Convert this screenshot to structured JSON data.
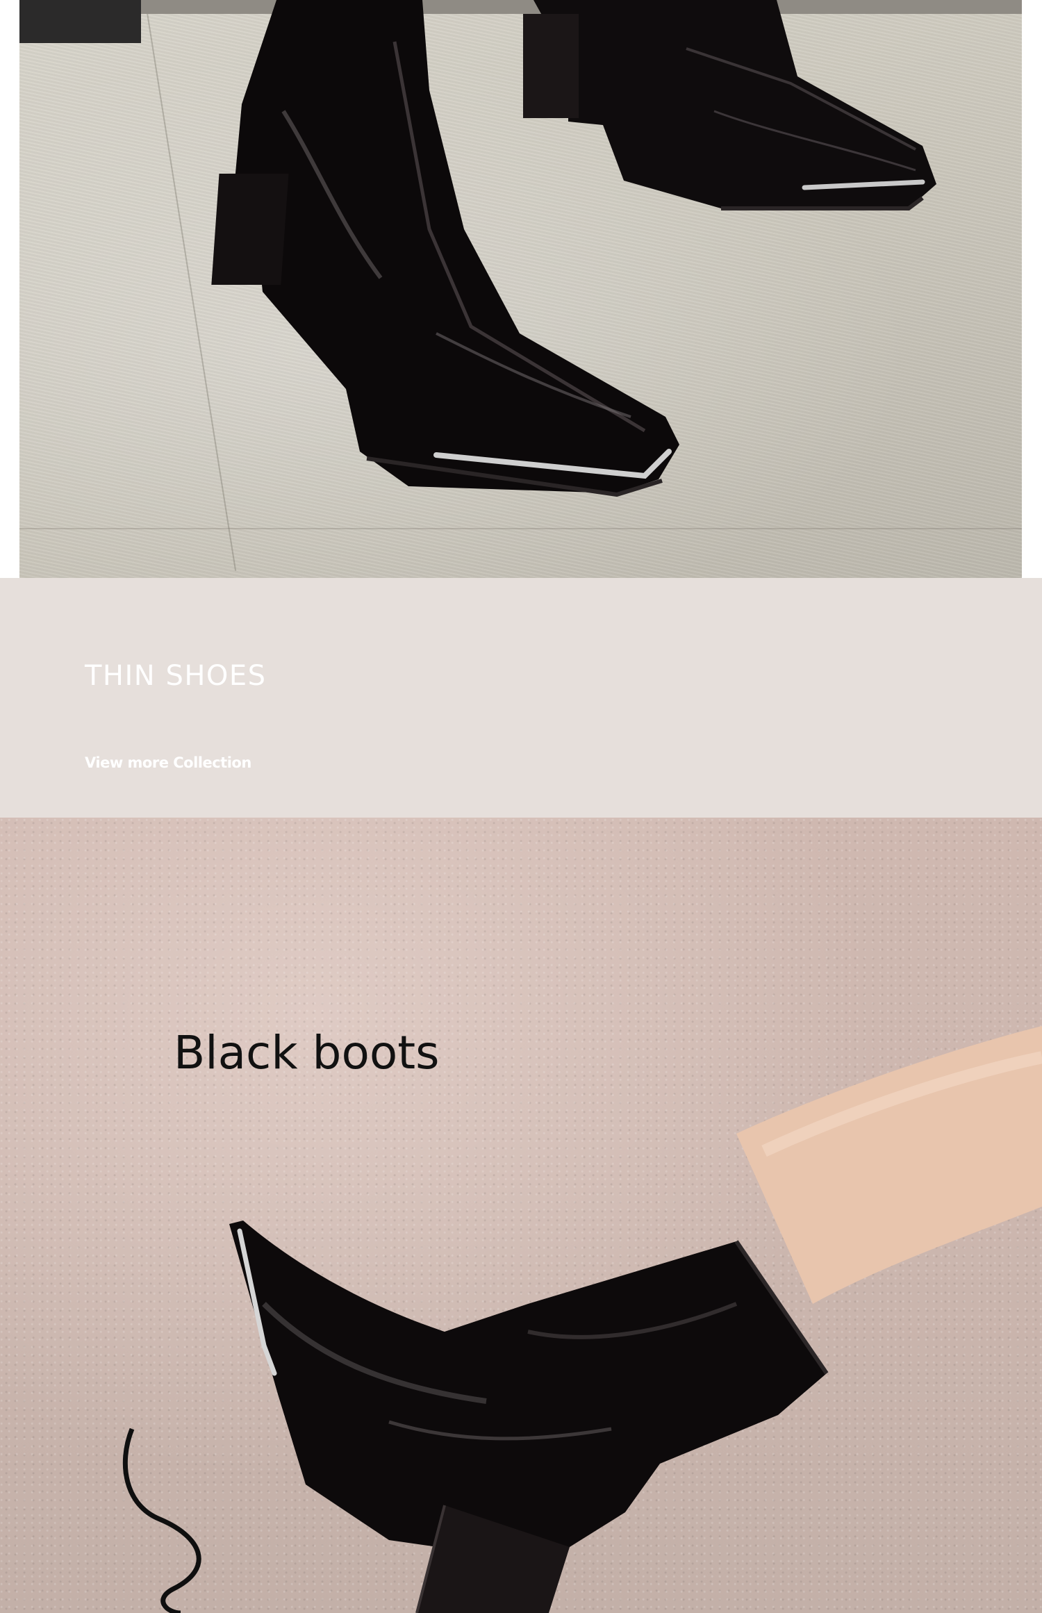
{
  "top_photo": {
    "icon": "patent-boots-on-floor-photo"
  },
  "banner": {
    "title": "THIN SHOES",
    "link_label": "View more Collection",
    "background_color": "#e6dfdb",
    "text_color": "#ffffff"
  },
  "bottom_photo": {
    "caption": "Black boots",
    "icon": "black-boot-on-wall-photo"
  }
}
